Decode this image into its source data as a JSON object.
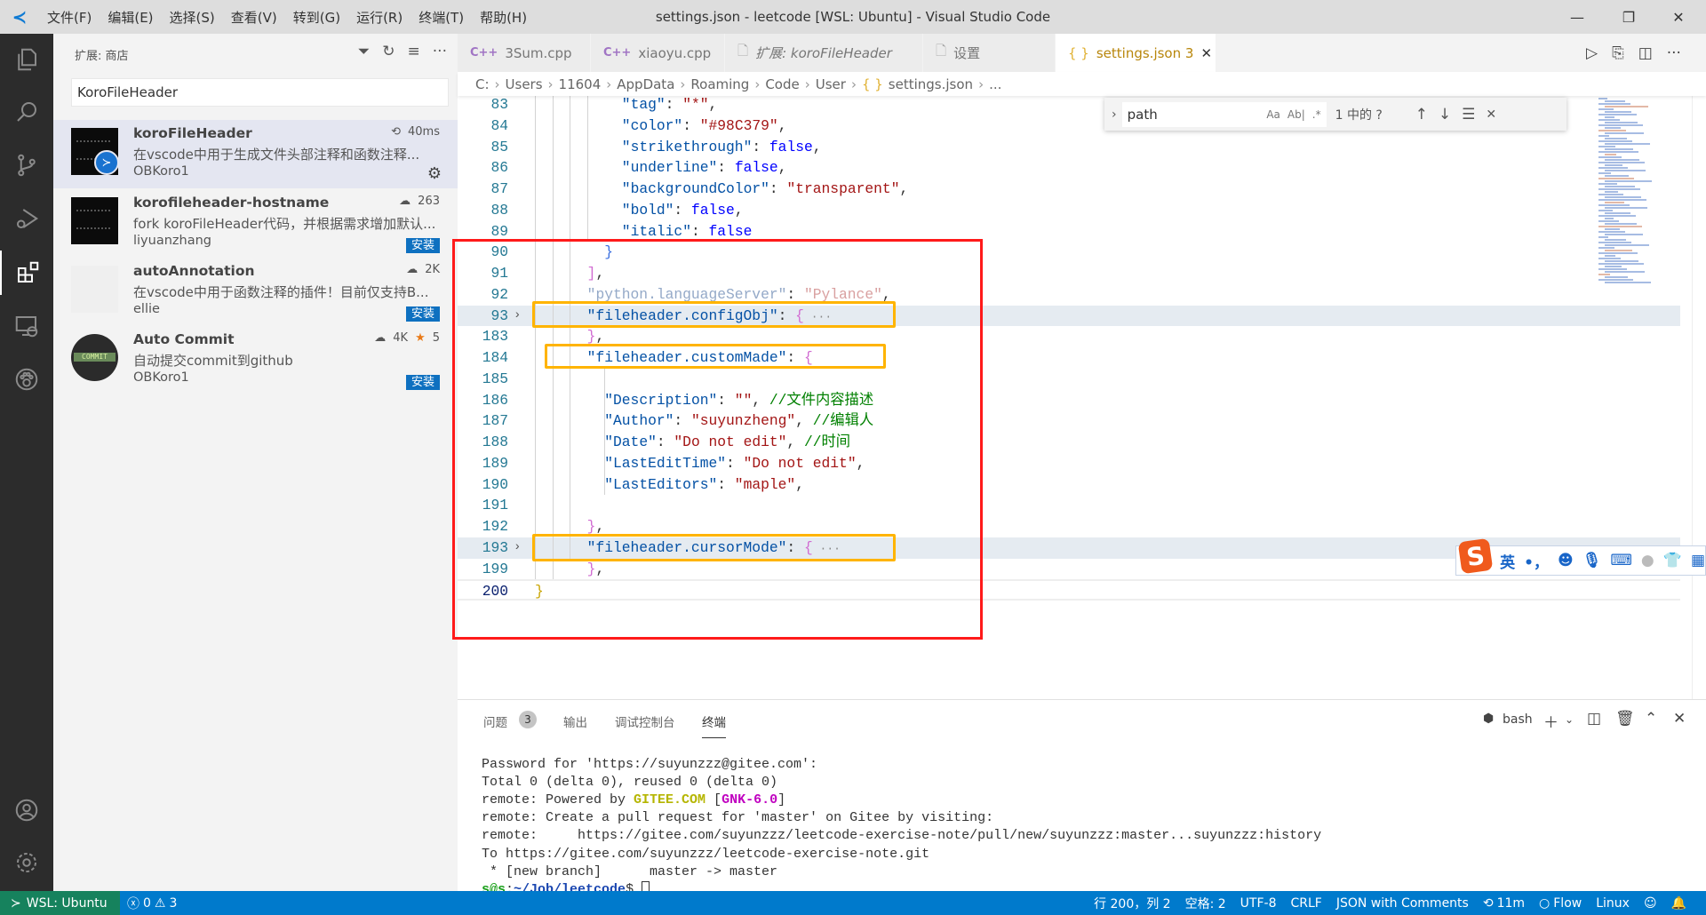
{
  "window": {
    "title": "settings.json - leetcode [WSL: Ubuntu] - Visual Studio Code",
    "menu": [
      "文件(F)",
      "编辑(E)",
      "选择(S)",
      "查看(V)",
      "转到(G)",
      "运行(R)",
      "终端(T)",
      "帮助(H)"
    ],
    "controls": {
      "minimize": "—",
      "restore": "❐",
      "close": "✕"
    }
  },
  "activity_bar": {
    "items": [
      "explorer-icon",
      "search-icon",
      "source-control-icon",
      "run-debug-icon",
      "extensions-icon",
      "remote-explorer-icon",
      "paw-icon"
    ],
    "active": "extensions-icon",
    "bottom": [
      "account-icon",
      "settings-gear-icon"
    ]
  },
  "sidebar": {
    "title": "扩展: 商店",
    "search_value": "KoroFileHeader",
    "extensions": [
      {
        "name": "koroFileHeader",
        "description": "在vscode中用于生成文件头部注释和函数注释...",
        "publisher": "OBKoro1",
        "meta": "40ms",
        "meta_icon": "history-icon",
        "installed": true
      },
      {
        "name": "korofileheader-hostname",
        "description": "fork koroFileHeader代码，并根据需求增加默认...",
        "publisher": "liyuanzhang",
        "downloads": "263",
        "install_label": "安装"
      },
      {
        "name": "autoAnnotation",
        "description": "在vscode中用于函数注释的插件！目前仅支持B...",
        "publisher": "ellie",
        "downloads": "2K",
        "install_label": "安装"
      },
      {
        "name": "Auto Commit",
        "description": "自动提交commit到github",
        "publisher": "OBKoro1",
        "downloads": "4K",
        "rating": "5",
        "install_label": "安装",
        "thumb_text": "COMMIT"
      }
    ]
  },
  "tabs": [
    {
      "label": "3Sum.cpp",
      "icon": "C++"
    },
    {
      "label": "xiaoyu.cpp",
      "icon": "C++"
    },
    {
      "label": "扩展: koroFileHeader",
      "icon": "file"
    },
    {
      "label": "设置",
      "icon": "file"
    },
    {
      "label": "settings.json",
      "icon": "{ }",
      "problems": "3",
      "active": true
    }
  ],
  "breadcrumb": [
    "C:",
    "Users",
    "11604",
    "AppData",
    "Roaming",
    "Code",
    "User",
    "settings.json",
    "..."
  ],
  "find_widget": {
    "value": "path",
    "options": [
      "Aa",
      "Ab|",
      ".*"
    ],
    "result": "1 中的 ?"
  },
  "editor": {
    "lines": [
      {
        "n": "83",
        "ind": 10,
        "t": [
          [
            "k",
            "\"tag\""
          ],
          [
            "p",
            ": "
          ],
          [
            "s",
            "\"*\""
          ],
          [
            "p",
            ","
          ]
        ]
      },
      {
        "n": "84",
        "ind": 10,
        "t": [
          [
            "k",
            "\"color\""
          ],
          [
            "p",
            ": "
          ],
          [
            "s",
            "\"#98C379\""
          ],
          [
            "p",
            ","
          ]
        ]
      },
      {
        "n": "85",
        "ind": 10,
        "t": [
          [
            "k",
            "\"strikethrough\""
          ],
          [
            "p",
            ": "
          ],
          [
            "b",
            "false"
          ],
          [
            "p",
            ","
          ]
        ]
      },
      {
        "n": "86",
        "ind": 10,
        "t": [
          [
            "k",
            "\"underline\""
          ],
          [
            "p",
            ": "
          ],
          [
            "b",
            "false"
          ],
          [
            "p",
            ","
          ]
        ]
      },
      {
        "n": "87",
        "ind": 10,
        "t": [
          [
            "k",
            "\"backgroundColor\""
          ],
          [
            "p",
            ": "
          ],
          [
            "s",
            "\"transparent\""
          ],
          [
            "p",
            ","
          ]
        ]
      },
      {
        "n": "88",
        "ind": 10,
        "t": [
          [
            "k",
            "\"bold\""
          ],
          [
            "p",
            ": "
          ],
          [
            "b",
            "false"
          ],
          [
            "p",
            ","
          ]
        ]
      },
      {
        "n": "89",
        "ind": 10,
        "t": [
          [
            "k",
            "\"italic\""
          ],
          [
            "p",
            ": "
          ],
          [
            "b",
            "false"
          ]
        ]
      },
      {
        "n": "90",
        "ind": 8,
        "t": [
          [
            "br2",
            "}"
          ]
        ]
      },
      {
        "n": "91",
        "ind": 6,
        "t": [
          [
            "br1",
            "]"
          ],
          [
            "p",
            ","
          ]
        ]
      },
      {
        "n": "92",
        "ind": 6,
        "t": [
          [
            "fk",
            "\"python.languageServer\""
          ],
          [
            "p",
            ": "
          ],
          [
            "fs",
            "\"Pylance\""
          ],
          [
            "p",
            ","
          ]
        ]
      },
      {
        "n": "93",
        "ind": 6,
        "fold": true,
        "hl": true,
        "t": [
          [
            "k",
            "\"fileheader.configObj\""
          ],
          [
            "p",
            ": "
          ],
          [
            "br1",
            "{"
          ],
          [
            "e",
            " ···"
          ]
        ]
      },
      {
        "n": "183",
        "ind": 6,
        "t": [
          [
            "br1",
            "}"
          ],
          [
            "p",
            ","
          ]
        ]
      },
      {
        "n": "184",
        "ind": 6,
        "t": [
          [
            "k",
            "\"fileheader.customMade\""
          ],
          [
            "p",
            ": "
          ],
          [
            "br1",
            "{"
          ]
        ]
      },
      {
        "n": "185",
        "ind": 0,
        "t": []
      },
      {
        "n": "186",
        "ind": 8,
        "t": [
          [
            "k",
            "\"Description\""
          ],
          [
            "p",
            ": "
          ],
          [
            "s",
            "\"\""
          ],
          [
            "p",
            ", "
          ],
          [
            "c",
            "//文件内容描述"
          ]
        ]
      },
      {
        "n": "187",
        "ind": 8,
        "t": [
          [
            "k",
            "\"Author\""
          ],
          [
            "p",
            ": "
          ],
          [
            "s",
            "\"suyunzheng\""
          ],
          [
            "p",
            ", "
          ],
          [
            "c",
            "//编辑人"
          ]
        ]
      },
      {
        "n": "188",
        "ind": 8,
        "t": [
          [
            "k",
            "\"Date\""
          ],
          [
            "p",
            ": "
          ],
          [
            "s",
            "\"Do not edit\""
          ],
          [
            "p",
            ", "
          ],
          [
            "c",
            "//时间"
          ]
        ]
      },
      {
        "n": "189",
        "ind": 8,
        "t": [
          [
            "k",
            "\"LastEditTime\""
          ],
          [
            "p",
            ": "
          ],
          [
            "s",
            "\"Do not edit\""
          ],
          [
            "p",
            ","
          ]
        ]
      },
      {
        "n": "190",
        "ind": 8,
        "t": [
          [
            "k",
            "\"LastEditors\""
          ],
          [
            "p",
            ": "
          ],
          [
            "s",
            "\"maple\""
          ],
          [
            "p",
            ","
          ]
        ]
      },
      {
        "n": "191",
        "ind": 0,
        "t": []
      },
      {
        "n": "192",
        "ind": 6,
        "t": [
          [
            "br1",
            "}"
          ],
          [
            "p",
            ","
          ]
        ]
      },
      {
        "n": "193",
        "ind": 6,
        "fold": true,
        "hl": true,
        "t": [
          [
            "k",
            "\"fileheader.cursorMode\""
          ],
          [
            "p",
            ": "
          ],
          [
            "br1",
            "{"
          ],
          [
            "e",
            " ···"
          ]
        ]
      },
      {
        "n": "199",
        "ind": 6,
        "t": [
          [
            "br1",
            "}"
          ],
          [
            "p",
            ","
          ]
        ]
      },
      {
        "n": "200",
        "ind": 0,
        "cur": true,
        "t": [
          [
            "br0",
            "}"
          ]
        ]
      }
    ]
  },
  "annotations": {
    "red_box_color": "#ff1a1a",
    "orange_box_color": "#ffb400"
  },
  "panel": {
    "tabs": [
      "问题",
      "输出",
      "调试控制台",
      "终端"
    ],
    "problems_count": "3",
    "active_tab": "终端",
    "shell": "bash",
    "terminal": [
      [
        [
          "",
          "Password for 'https://suyunzzz@gitee.com':"
        ]
      ],
      [
        [
          "",
          "Total 0 (delta 0), reused 0 (delta 0)"
        ]
      ],
      [
        [
          "",
          "remote: Powered by "
        ],
        [
          "tg",
          "GITEE.COM"
        ],
        [
          "",
          " ["
        ],
        [
          "tm",
          "GNK-6.0"
        ],
        [
          "",
          "]"
        ]
      ],
      [
        [
          "",
          "remote: Create a pull request for 'master' on Gitee by visiting:"
        ]
      ],
      [
        [
          "",
          "remote:     https://gitee.com/suyunzzz/leetcode-exercise-note/pull/new/suyunzzz:master...suyunzzz:history"
        ]
      ],
      [
        [
          "",
          "To https://gitee.com/suyunzzz/leetcode-exercise-note.git"
        ]
      ],
      [
        [
          "",
          " * [new branch]      master -> master"
        ]
      ],
      [
        [
          "tgr",
          "s@s"
        ],
        [
          "",
          ":"
        ],
        [
          "tbl",
          "~/Job/leetcode"
        ],
        [
          "",
          "$ "
        ]
      ]
    ]
  },
  "statusbar": {
    "remote": "WSL: Ubuntu",
    "errors": "0",
    "warnings": "3",
    "position": "行 200，列 2",
    "indent": "空格: 2",
    "encoding": "UTF-8",
    "eol": "CRLF",
    "language": "JSON with Comments",
    "timer": "11m",
    "flow": "Flow",
    "os": "Linux"
  },
  "ime_toolbar": {
    "logo": "S",
    "mode": "英",
    "punct": "•，"
  },
  "colors": {
    "accent": "#007acc",
    "remote": "#16825d",
    "install": "#0e70c0"
  }
}
